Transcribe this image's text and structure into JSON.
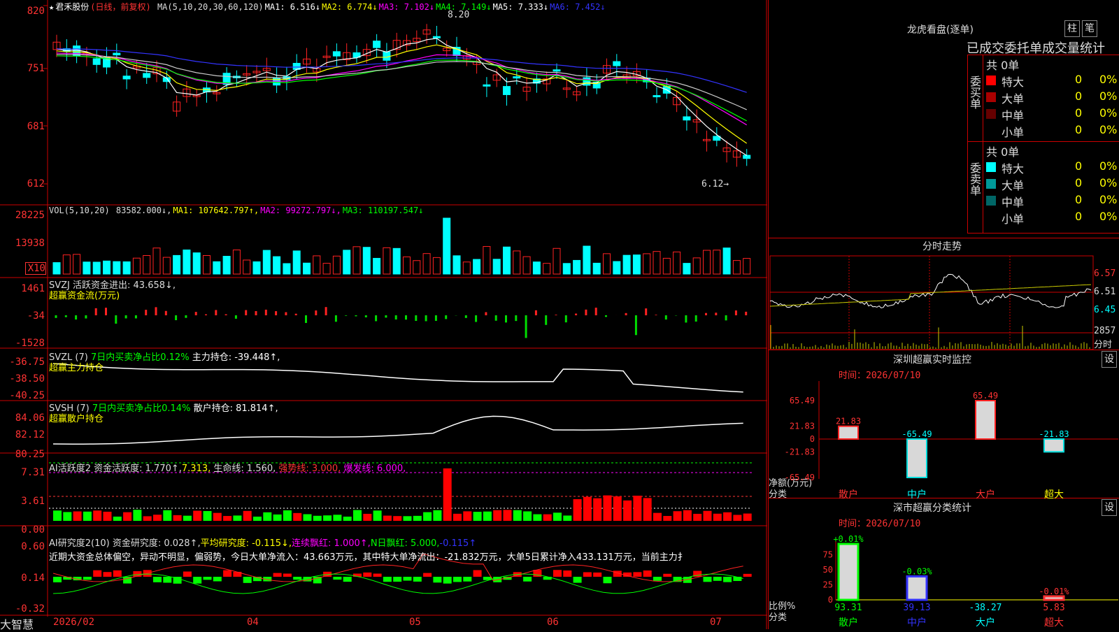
{
  "stock": {
    "star": "★",
    "name": "君禾股份",
    "mode": "(日线，前复权)",
    "ma_params": "MA(5,10,20,30,60,120)",
    "ma": [
      {
        "label": "MA1: 6.516↓",
        "color": "#ffffff"
      },
      {
        "label": "MA2: 6.774↓",
        "color": "#ffff00"
      },
      {
        "label": "MA3: 7.102↓",
        "color": "#ff00ff"
      },
      {
        "label": "MA4: 7.149↓",
        "color": "#00ff00"
      },
      {
        "label": "MA5: 7.333↓",
        "color": "#ffffff"
      },
      {
        "label": "MA6: 7.452↓",
        "color": "#3333ff"
      }
    ],
    "high_label": "8.20",
    "low_label": "6.12→"
  },
  "axes": {
    "price": [
      "820",
      "751",
      "681",
      "612"
    ],
    "vol": [
      "28225",
      "13938",
      "X10"
    ],
    "svzj": [
      "1461",
      "-34",
      "-1528"
    ],
    "svzl": [
      "-36.75",
      "-38.50",
      "-40.25"
    ],
    "svsh": [
      "84.06",
      "82.12",
      "80.25"
    ],
    "ai": [
      "7.31",
      "3.61",
      "0.00"
    ],
    "res": [
      "0.60",
      "0.14",
      "-0.32"
    ],
    "dates": [
      "2026/02",
      "04",
      "05",
      "06",
      "07"
    ]
  },
  "vol_legend": [
    {
      "t": "VOL(5,10,20) ",
      "c": "#dddddd"
    },
    {
      "t": "83582.000↓,",
      "c": "#dddddd"
    },
    {
      "t": "MA1: 107642.797↑,",
      "c": "#ffff00"
    },
    {
      "t": "MA2: 99272.797↓,",
      "c": "#ff00ff"
    },
    {
      "t": "MA3: 110197.547↓",
      "c": "#00ff00"
    }
  ],
  "svzj_legend": {
    "l1": "SVZJ  活跃资金进出: 43.658↓,",
    "l2": "超赢资金流(万元)"
  },
  "svzl_legend": {
    "p": "SVZL (7) ",
    "g": "7日内买卖净占比0.12%",
    "w": " 主力持仓: -39.448↑,",
    "l2": "超赢主力持仓"
  },
  "svsh_legend": {
    "p": "SVSH (7) ",
    "g": "7日内买卖净占比0.14%",
    "w": " 散户持仓: 81.814↑,",
    "l2": "超赢散户持仓"
  },
  "ai_legend": [
    {
      "t": "AI活跃度2 ",
      "c": "#dddddd"
    },
    {
      "t": "资金活跃度: 1.770↑,",
      "c": "#dddddd"
    },
    {
      "t": "7.313,",
      "c": "#ffff00"
    },
    {
      "t": " 生命线: 1.560,",
      "c": "#dddddd"
    },
    {
      "t": " 强势线: 3.000,",
      "c": "#ff3333"
    },
    {
      "t": " 爆发线: 6.000,",
      "c": "#ff00ff"
    }
  ],
  "res_legend": [
    {
      "t": "AI研究度2(10) ",
      "c": "#dddddd"
    },
    {
      "t": "资金研究度: 0.028↑,",
      "c": "#dddddd"
    },
    {
      "t": "平均研究度: -0.115↓,",
      "c": "#ffff00"
    },
    {
      "t": "连续飘红: 1.000↑,",
      "c": "#ff00ff"
    },
    {
      "t": "N日飘红: 5.000,",
      "c": "#00ff00"
    },
    {
      "t": "-0.115↑",
      "c": "#3333ff"
    }
  ],
  "commentary": "近期大资金总体偏空，异动不明显，偏弱势，今日大单净流入：43.663万元，其中特大单净流出：-21.832万元，大单5日累计净入433.131万元，当前主力扌",
  "footer": "大智慧",
  "lhb": {
    "title": "龙虎看盘(逐单)",
    "btn1": "柱",
    "btn2": "笔",
    "tabs": "已成交委托单成交量统计",
    "buy_label": "委买单",
    "sell_label": "委卖单",
    "buy_total": "共 0单",
    "sell_total": "共 0单",
    "buy_rows": [
      {
        "name": "特大",
        "n": "0",
        "p": "0%",
        "c": "#ff0000"
      },
      {
        "name": "大单",
        "n": "0",
        "p": "0%",
        "c": "#aa0000"
      },
      {
        "name": "中单",
        "n": "0",
        "p": "0%",
        "c": "#660000"
      },
      {
        "name": "小单",
        "n": "0",
        "p": "0%",
        "c": ""
      }
    ],
    "sell_rows": [
      {
        "name": "特大",
        "n": "0",
        "p": "0%",
        "c": "#00ffff"
      },
      {
        "name": "大单",
        "n": "0",
        "p": "0%",
        "c": "#009999"
      },
      {
        "name": "中单",
        "n": "0",
        "p": "0%",
        "c": "#006666"
      },
      {
        "name": "小单",
        "n": "0",
        "p": "0%",
        "c": ""
      }
    ]
  },
  "intraday": {
    "title": "分时走势",
    "p1": "6.57",
    "p2": "6.51",
    "p3": "6.45",
    "vol": "2857",
    "unit": "分时"
  },
  "sz_monitor": {
    "title": "深圳超赢实时监控",
    "btn": "设",
    "time": "时间：2026/07/10",
    "yticks": [
      "65.49",
      "21.83",
      "0",
      "-21.83",
      "-65.49"
    ],
    "ylabel": "净额(万元)",
    "xlabel": "分类",
    "cats": [
      "散户",
      "中户",
      "大户",
      "超大"
    ],
    "values": [
      "21.83",
      "-65.49",
      "65.49",
      "-21.83"
    ]
  },
  "sz_stat": {
    "title": "深市超赢分类统计",
    "btn": "设",
    "time": "时间：2026/07/10",
    "yticks": [
      "75",
      "50",
      "25",
      "0"
    ],
    "ylabel": "比例%",
    "xlabel": "分类",
    "cats": [
      "散户",
      "中户",
      "大户",
      "超大"
    ],
    "top": [
      "+0.01%",
      "-0.03%",
      "",
      "-0.01%"
    ],
    "bottom": [
      "93.31",
      "39.13",
      "-38.27",
      "5.83"
    ]
  },
  "chart_data": {
    "type": "candlestick",
    "title": "君禾股份 (日线，前复权)",
    "price_range": [
      612,
      820
    ],
    "high": 8.2,
    "low": 6.12,
    "x_labels": [
      "2026/02",
      "04",
      "05",
      "06",
      "07"
    ]
  }
}
